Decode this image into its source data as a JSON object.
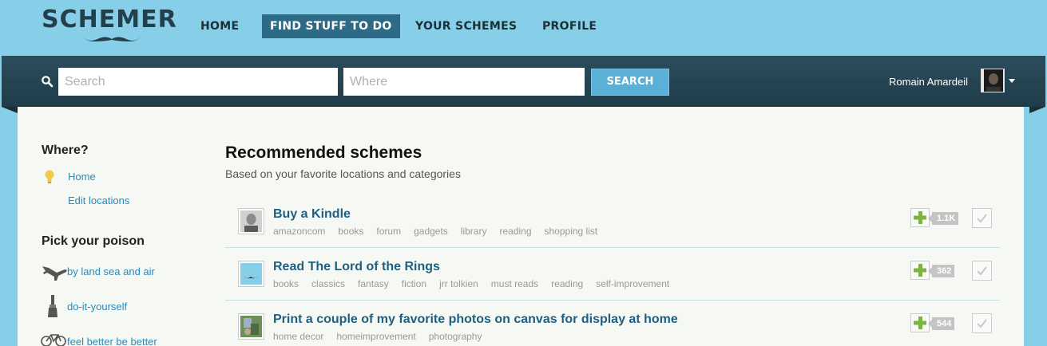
{
  "app": {
    "logo": "SCHEMER"
  },
  "nav": {
    "home": "HOME",
    "find": "FIND STUFF TO DO",
    "schemes": "YOUR SCHEMES",
    "profile": "PROFILE"
  },
  "search": {
    "what_placeholder": "Search",
    "where_placeholder": "Where",
    "button": "SEARCH"
  },
  "user": {
    "name": "Romain Amardeil"
  },
  "sidebar": {
    "where_heading": "Where?",
    "home_link": "Home",
    "edit_link": "Edit locations",
    "poison_heading": "Pick your poison",
    "categories": [
      "by land sea and air",
      "do-it-yourself",
      "feel better be better"
    ]
  },
  "main": {
    "title": "Recommended schemes",
    "subtitle": "Based on your favorite locations and categories",
    "schemes": [
      {
        "title": "Buy a Kindle",
        "count": "1.1K",
        "tags": [
          "amazoncom",
          "books",
          "forum",
          "gadgets",
          "library",
          "reading",
          "shopping list"
        ]
      },
      {
        "title": "Read The Lord of the Rings",
        "count": "362",
        "tags": [
          "books",
          "classics",
          "fantasy",
          "fiction",
          "jrr tolkien",
          "must reads",
          "reading",
          "self-improvement"
        ]
      },
      {
        "title": "Print a couple of my favorite photos on canvas for display at home",
        "count": "544",
        "tags": [
          "home decor",
          "homeimprovement",
          "photography"
        ]
      }
    ]
  },
  "colors": {
    "sky": "#87cfe8",
    "band": "#244553",
    "link": "#2a8ab9",
    "plus": "#7cb342"
  }
}
